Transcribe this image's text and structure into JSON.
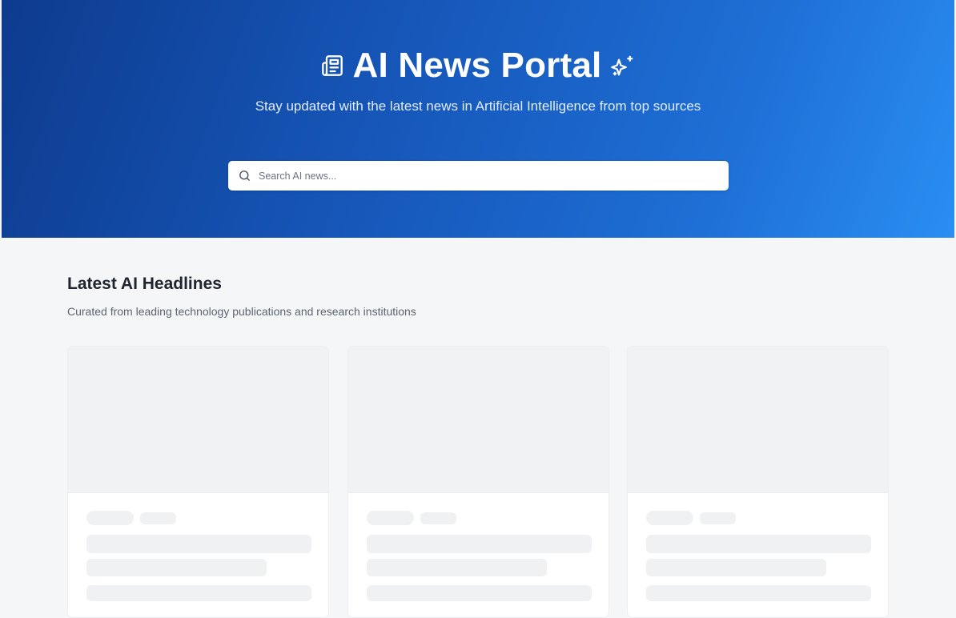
{
  "hero": {
    "title": "AI News Portal",
    "subtitle": "Stay updated with the latest news in Artificial Intelligence from top sources",
    "left_icon": "newspaper-icon",
    "right_icon": "sparkles-icon"
  },
  "search": {
    "placeholder": "Search AI news...",
    "icon": "search-icon"
  },
  "section": {
    "title": "Latest AI Headlines",
    "subtitle": "Curated from leading technology publications and research institutions"
  },
  "cards": [
    {
      "state": "loading"
    },
    {
      "state": "loading"
    },
    {
      "state": "loading"
    }
  ],
  "colors": {
    "hero_gradient_start": "#0d3b8e",
    "hero_gradient_end": "#2a8ef2",
    "page_background": "#f5f6f8",
    "skeleton": "#f0f1f3"
  }
}
